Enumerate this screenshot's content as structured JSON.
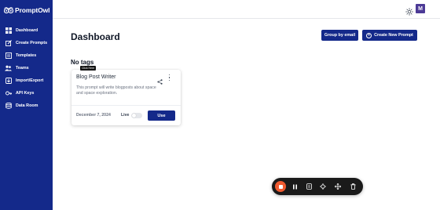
{
  "app": {
    "logo_text": "PromptOwl"
  },
  "sidebar": {
    "items": [
      {
        "label": "Dashboard",
        "icon": "dashboard-icon"
      },
      {
        "label": "Create Prompts",
        "icon": "edit-icon"
      },
      {
        "label": "Templates",
        "icon": "templates-icon"
      },
      {
        "label": "Teams",
        "icon": "teams-icon"
      },
      {
        "label": "Import/Export",
        "icon": "import-export-icon"
      },
      {
        "label": "API Keys",
        "icon": "key-icon"
      },
      {
        "label": "Data Room",
        "icon": "database-icon"
      }
    ]
  },
  "header": {
    "avatar_initial": "M",
    "theme_icon": "sun-icon"
  },
  "main": {
    "title": "Dashboard",
    "group_button": "Group by email",
    "create_button": "Create New Prompt",
    "section_heading": "No tags",
    "tooltip": "Click Here"
  },
  "card": {
    "title": "Blog Post Writer",
    "description": "This prompt will write blogposts about space and space exploration.",
    "date": "December 7, 2024",
    "live_label": "Live",
    "live_on": false,
    "use_button": "Use"
  },
  "colors": {
    "brand": "#14298a",
    "record": "#ef5a30",
    "toolbar": "#1a1a1a"
  }
}
